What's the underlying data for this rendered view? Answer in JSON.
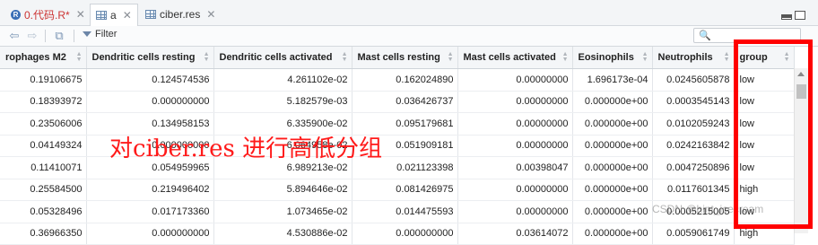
{
  "tabs": [
    {
      "label": "0.代码.R*",
      "icon": "r-script-icon",
      "active": false
    },
    {
      "label": "a",
      "icon": "data-grid-icon",
      "active": true
    },
    {
      "label": "ciber.res",
      "icon": "data-grid-icon",
      "active": false
    }
  ],
  "toolbar": {
    "filter_label": "Filter",
    "search_placeholder": ""
  },
  "columns": [
    "rophages M2",
    "Dendritic cells resting",
    "Dendritic cells activated",
    "Mast cells resting",
    "Mast cells activated",
    "Eosinophils",
    "Neutrophils",
    "group"
  ],
  "rows": [
    [
      "0.19106675",
      "0.124574536",
      "4.261102e-02",
      "0.162024890",
      "0.00000000",
      "1.696173e-04",
      "0.0245605878",
      "low"
    ],
    [
      "0.18393972",
      "0.000000000",
      "5.182579e-03",
      "0.036426737",
      "0.00000000",
      "0.000000e+00",
      "0.0003545143",
      "low"
    ],
    [
      "0.23506006",
      "0.134958153",
      "6.335900e-02",
      "0.095179681",
      "0.00000000",
      "0.000000e+00",
      "0.0102059243",
      "low"
    ],
    [
      "0.04149324",
      "0.000000000",
      "6.064958e-02",
      "0.051909181",
      "0.00000000",
      "0.000000e+00",
      "0.0242163842",
      "low"
    ],
    [
      "0.11410071",
      "0.054959965",
      "6.989213e-02",
      "0.021123398",
      "0.00398047",
      "0.000000e+00",
      "0.0047250896",
      "low"
    ],
    [
      "0.25584500",
      "0.219496402",
      "5.894646e-02",
      "0.081426975",
      "0.00000000",
      "0.000000e+00",
      "0.0117601345",
      "high"
    ],
    [
      "0.05328496",
      "0.017173360",
      "1.073465e-02",
      "0.014475593",
      "0.00000000",
      "0.000000e+00",
      "0.0005215005",
      "low"
    ],
    [
      "0.36966350",
      "0.000000000",
      "4.530886e-02",
      "0.000000000",
      "0.03614072",
      "0.000000e+00",
      "0.0059061749",
      "high"
    ]
  ],
  "annotation": "对ciber.res 进行高低分组",
  "watermark": "CSDN @hint_icecream",
  "colors": {
    "highlight_box": "#ff0000",
    "annotation_text": "#ff1a1a"
  }
}
